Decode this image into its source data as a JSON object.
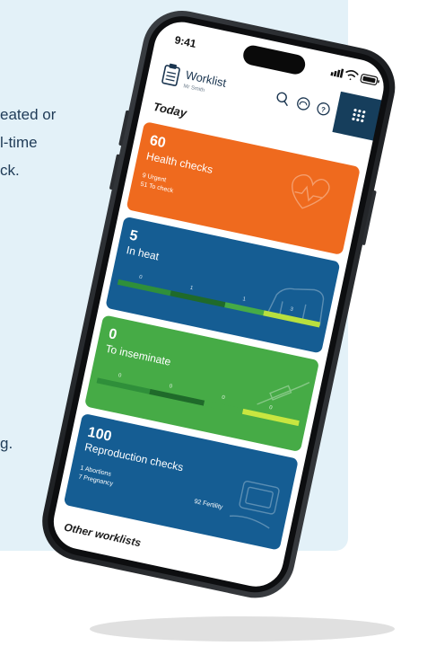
{
  "background": {
    "text_lines": [
      "eated or",
      "l-time",
      "ck.",
      "g."
    ],
    "panel_color": "#e3f1f8"
  },
  "status_bar": {
    "time": "9:41",
    "icons": [
      "cellular-signal-icon",
      "wifi-icon",
      "battery-icon"
    ]
  },
  "header": {
    "title": "Worklist",
    "subtitle": "Mr Smith",
    "icons": [
      "clipboard-list-icon",
      "search-icon",
      "cloud-sync-icon",
      "help-icon",
      "grid-menu-icon"
    ]
  },
  "section_today": "Today",
  "filter_icon": "filter-icon",
  "cards": {
    "health": {
      "count": "60",
      "title": "Health checks",
      "line1": "9 Urgent",
      "line2": "51 To check",
      "color": "#ef6a1e",
      "icon": "heart-cow-icon"
    },
    "heat": {
      "count": "5",
      "title": "In heat",
      "bar_labels": [
        "0",
        "1",
        "1",
        "3"
      ],
      "color": "#155d93",
      "icon": "cow-mounting-icon"
    },
    "inseminate": {
      "count": "0",
      "title": "To inseminate",
      "bar_labels": [
        "0",
        "0",
        "0",
        "0"
      ],
      "color": "#46ab46",
      "icon": "syringe-icon"
    },
    "repro": {
      "count": "100",
      "title": "Reproduction checks",
      "line1": "1 Abortions",
      "line2": "7 Pregnancy",
      "line3": "92 Fertility",
      "color": "#155d93",
      "icon": "ultrasound-scanner-icon"
    }
  },
  "section_other": "Other worklists"
}
